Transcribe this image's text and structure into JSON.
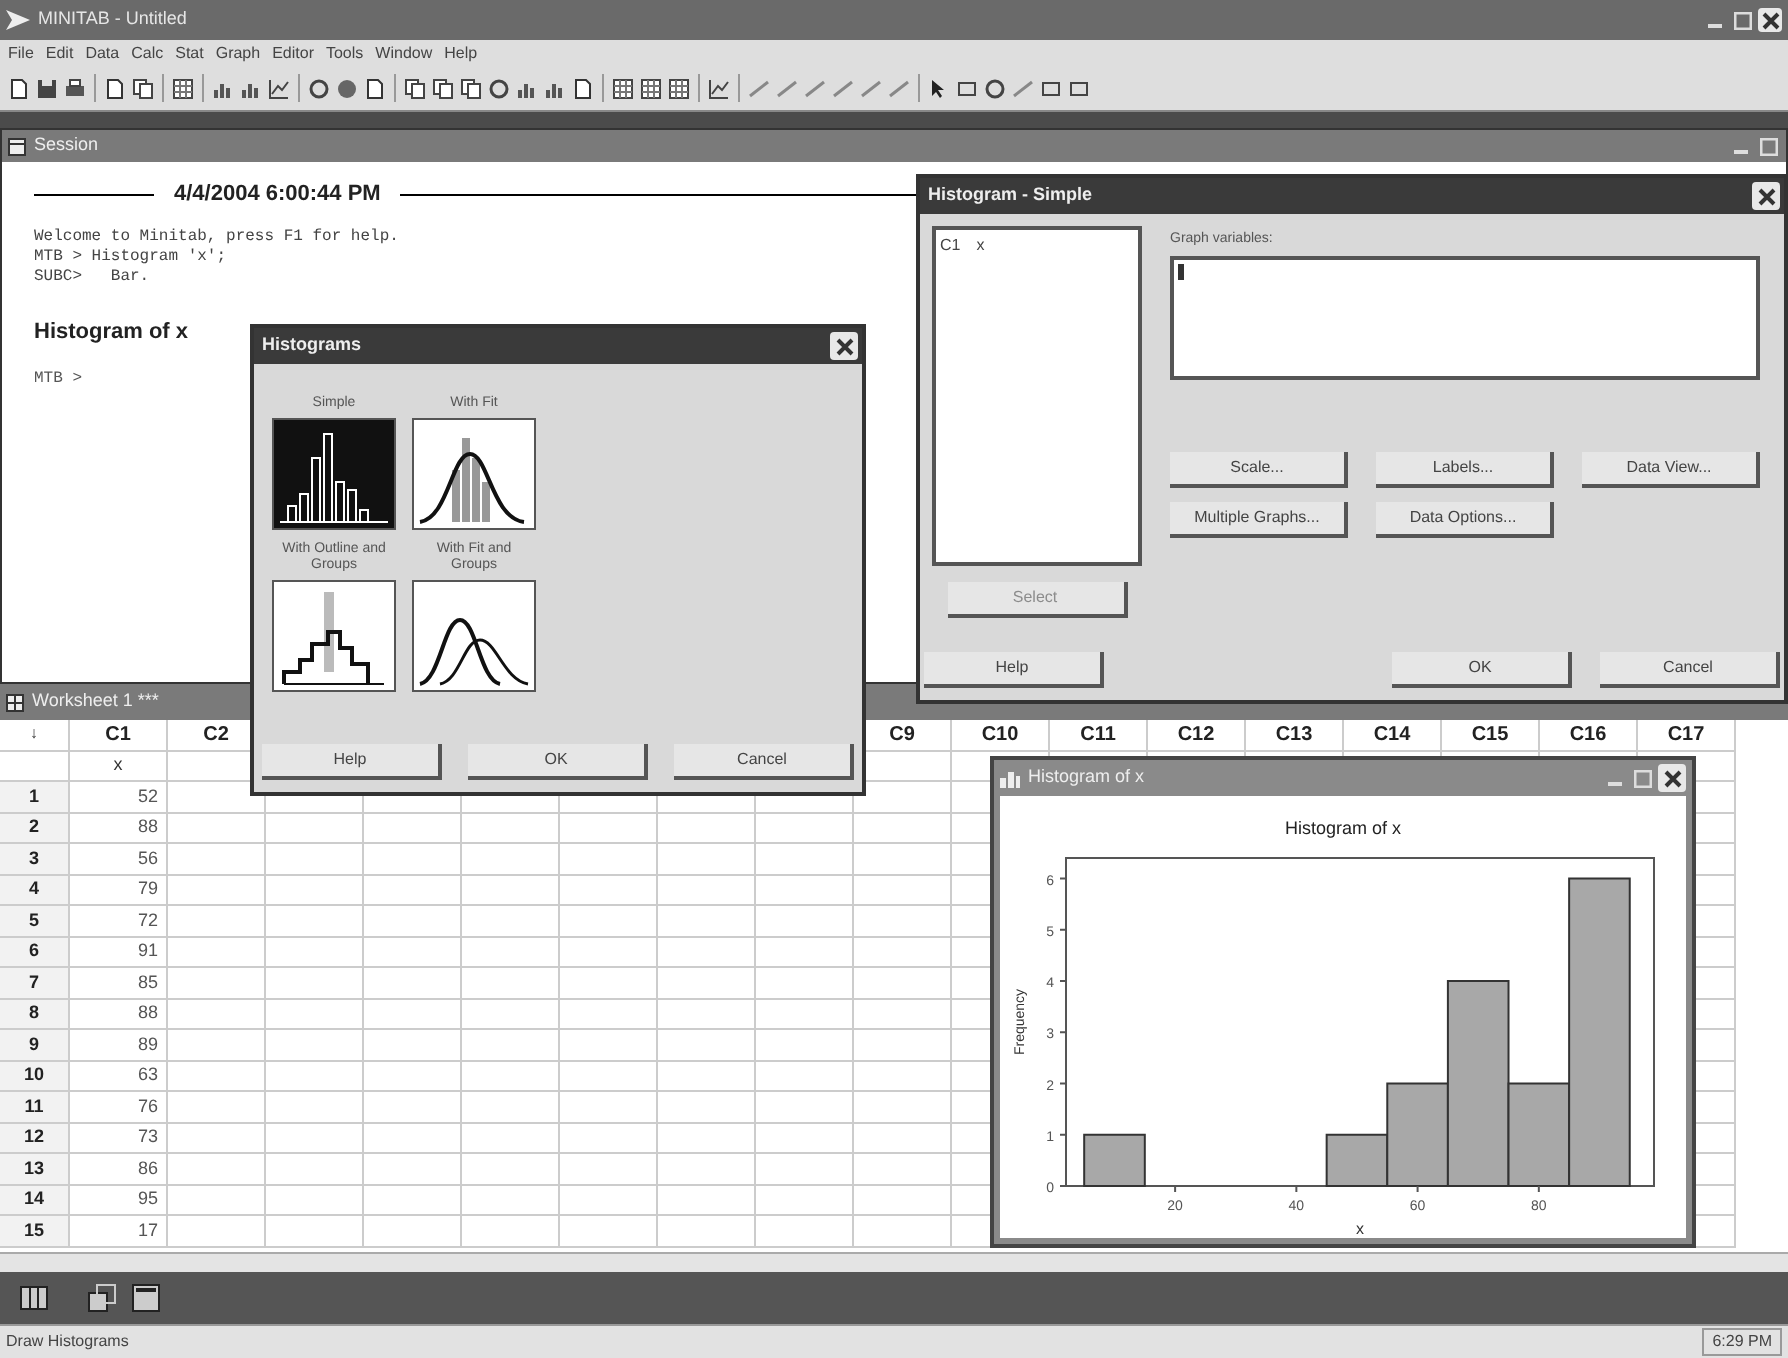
{
  "app_window": {
    "title": "MINITAB - Untitled"
  },
  "menu_bar": [
    "File",
    "Edit",
    "Data",
    "Calc",
    "Stat",
    "Graph",
    "Editor",
    "Tools",
    "Window",
    "Help"
  ],
  "session": {
    "title": "Session",
    "timestamp": "4/4/2004 6:00:44 PM",
    "lines": [
      "Welcome to Minitab, press F1 for help.",
      "MTB > Histogram 'x';",
      "SUBC>   Bar."
    ],
    "heading": "Histogram of x",
    "prompt": "MTB >"
  },
  "worksheet": {
    "title": "Worksheet 1 ***",
    "corner": "↓",
    "columns": [
      {
        "label": "C1",
        "name": "x",
        "values": [
          "52",
          "88",
          "56",
          "79",
          "72",
          "91",
          "85",
          "88",
          "89",
          "63",
          "76",
          "73",
          "86",
          "95",
          "17"
        ]
      },
      {
        "label": "C2"
      },
      {
        "label": "C9"
      },
      {
        "label": "C10"
      },
      {
        "label": "C11"
      },
      {
        "label": "C12"
      },
      {
        "label": "C13"
      },
      {
        "label": "C14"
      },
      {
        "label": "C15"
      },
      {
        "label": "C16"
      },
      {
        "label": "C17"
      }
    ],
    "row_numbers": [
      "1",
      "2",
      "3",
      "4",
      "5",
      "6",
      "7",
      "8",
      "9",
      "10",
      "11",
      "12",
      "13",
      "14",
      "15"
    ]
  },
  "histograms_dialog": {
    "title": "Histograms",
    "options": [
      {
        "label": "Simple",
        "kind": "simple",
        "selected": true
      },
      {
        "label": "With Fit",
        "kind": "fit",
        "selected": false
      },
      {
        "label": "With Outline and Groups",
        "kind": "outline",
        "selected": false
      },
      {
        "label": "With Fit and Groups",
        "kind": "fit_groups",
        "selected": false
      }
    ],
    "buttons": [
      "Help",
      "OK",
      "Cancel"
    ]
  },
  "simple_dialog": {
    "title": "Histogram - Simple",
    "variables": [
      {
        "column": "C1",
        "name": "x"
      }
    ],
    "graph_variables_label": "Graph variables:",
    "option_rows": [
      [
        "Scale...",
        "Labels...",
        "Data View..."
      ],
      [
        "Multiple Graphs...",
        "Data Options..."
      ]
    ],
    "select_button": {
      "label": "Select",
      "disabled": true
    },
    "buttons": [
      "Help",
      "OK",
      "Cancel"
    ]
  },
  "graph_window": {
    "title": "Histogram of x",
    "chart_data": {
      "type": "bar",
      "title": "Histogram of x",
      "xlabel": "x",
      "ylabel": "Frequency",
      "x": [
        10,
        50,
        60,
        70,
        80,
        90
      ],
      "values": [
        1,
        1,
        2,
        4,
        2,
        6
      ],
      "xlim": [
        2,
        99
      ],
      "ylim": [
        0,
        6.4
      ],
      "xticks": [
        20,
        40,
        60,
        80
      ],
      "yticks": [
        0,
        1,
        2,
        3,
        4,
        5,
        6
      ]
    }
  },
  "status_bar": {
    "message": "Draw Histograms",
    "time": "6:29 PM"
  }
}
